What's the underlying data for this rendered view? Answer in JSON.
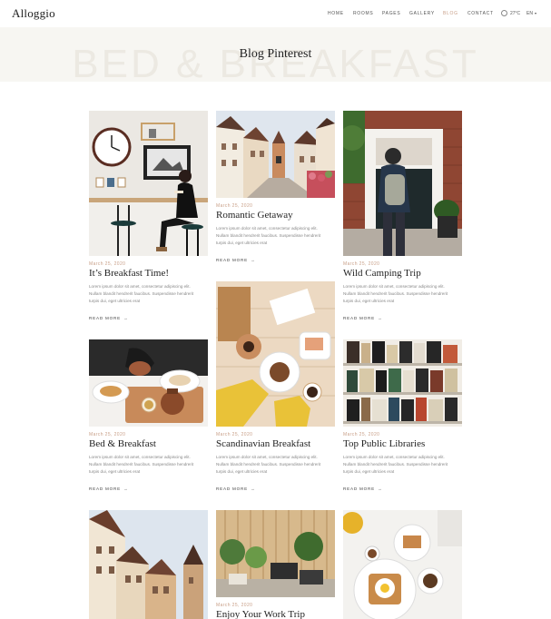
{
  "header": {
    "logo": "Alloggio",
    "nav": [
      "HOME",
      "ROOMS",
      "PAGES",
      "GALLERY",
      "BLOG",
      "CONTACT"
    ],
    "active_nav": "BLOG",
    "weather_temp": "27°C",
    "language": "EN"
  },
  "hero": {
    "title": "Blog Pinterest",
    "background_text": "BED & BREAKFAST"
  },
  "posts": [
    {
      "date": "March 25, 2020",
      "title": "It’s Breakfast Time!",
      "excerpt": "Lorem ipsum dolor sit amet, consectetur adipiscing elit. Nullam blandit hendrerit faucibus. Suspendisse hendrerit turpis dui, eget ultricies erat",
      "read_more": "READ MORE"
    },
    {
      "date": "March 25, 2020",
      "title": "Romantic Getaway",
      "excerpt": "Lorem ipsum dolor sit amet, consectetur adipiscing elit. Nullam blandit hendrerit faucibus. Suspendisse hendrerit turpis dui, eget ultricies erat",
      "read_more": "READ MORE"
    },
    {
      "date": "March 25, 2020",
      "title": "Wild Camping Trip",
      "excerpt": "Lorem ipsum dolor sit amet, consectetur adipiscing elit. Nullam blandit hendrerit faucibus. Suspendisse hendrerit turpis dui, eget ultricies erat",
      "read_more": "READ MORE"
    },
    {
      "date": "March 25, 2020",
      "title": "Bed & Breakfast",
      "excerpt": "Lorem ipsum dolor sit amet, consectetur adipiscing elit. Nullam blandit hendrerit faucibus. Suspendisse hendrerit turpis dui, eget ultricies erat",
      "read_more": "READ MORE"
    },
    {
      "date": "March 25, 2020",
      "title": "Scandinavian Breakfast",
      "excerpt": "Lorem ipsum dolor sit amet, consectetur adipiscing elit. Nullam blandit hendrerit faucibus. Suspendisse hendrerit turpis dui, eget ultricies erat",
      "read_more": "READ MORE"
    },
    {
      "date": "March 25, 2020",
      "title": "Top Public Libraries",
      "excerpt": "Lorem ipsum dolor sit amet, consectetur adipiscing elit. Nullam blandit hendrerit faucibus. Suspendisse hendrerit turpis dui, eget ultricies erat",
      "read_more": "READ MORE"
    },
    {
      "date": "",
      "title": "",
      "excerpt": "",
      "read_more": ""
    },
    {
      "date": "March 25, 2020",
      "title": "Enjoy Your Work Trip",
      "excerpt": "",
      "read_more": ""
    },
    {
      "date": "",
      "title": "",
      "excerpt": "",
      "read_more": ""
    }
  ],
  "colors": {
    "accent": "#c9a089",
    "band_background": "#f7f6f2",
    "text": "#222222",
    "muted_text": "#888888"
  }
}
